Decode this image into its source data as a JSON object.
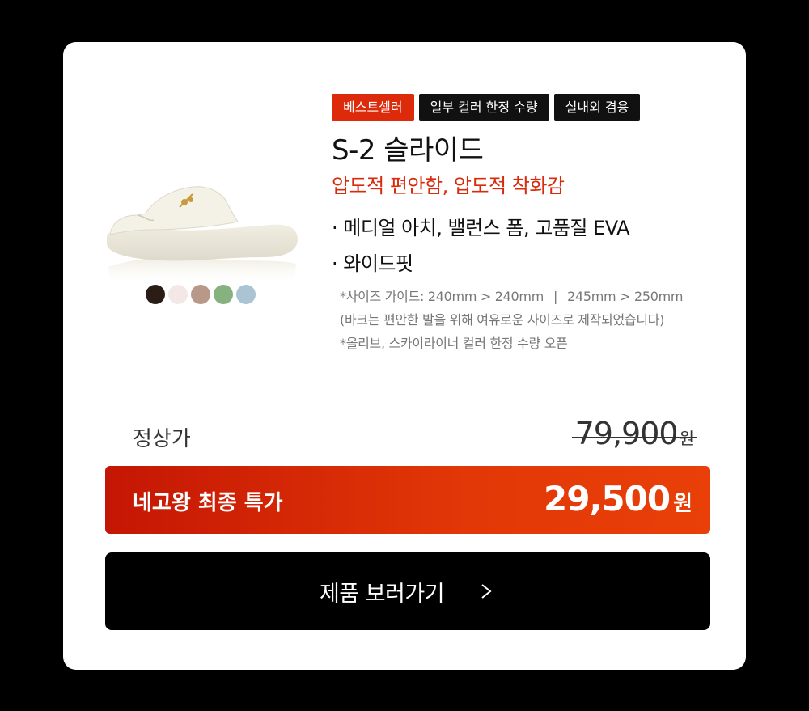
{
  "badges": [
    "베스트셀러",
    "일부 컬러 한정 수량",
    "실내외 겸용"
  ],
  "product": {
    "title": "S-2 슬라이드",
    "subtitle": "압도적 편안함, 압도적 착화감",
    "features": [
      "· 메디얼 아치, 밸런스 폼, 고품질 EVA",
      "· 와이드핏"
    ],
    "size_guide": {
      "prefix": "*사이즈 가이드: ",
      "first": "240mm > 240mm",
      "separator": "|",
      "second": "245mm > 250mm"
    },
    "size_note": "(바크는 편안한 발을 위해 여유로운 사이즈로 제작되었습니다)",
    "color_note": "*올리브, 스카이라이너 컬러 한정 수량 오픈",
    "colors": [
      "#2b1d16",
      "#f3e8e6",
      "#b89888",
      "#86b27f",
      "#aac4d4"
    ]
  },
  "pricing": {
    "regular_label": "정상가",
    "regular_price": "79,900",
    "sale_label": "네고왕 최종 특가",
    "sale_price": "29,500",
    "currency": "원"
  },
  "cta": {
    "label": "제품 보러가기",
    "icon": "chevron-right-icon"
  },
  "theme": {
    "accent": "#dd2a0a",
    "background": "#000000",
    "card": "#ffffff"
  }
}
